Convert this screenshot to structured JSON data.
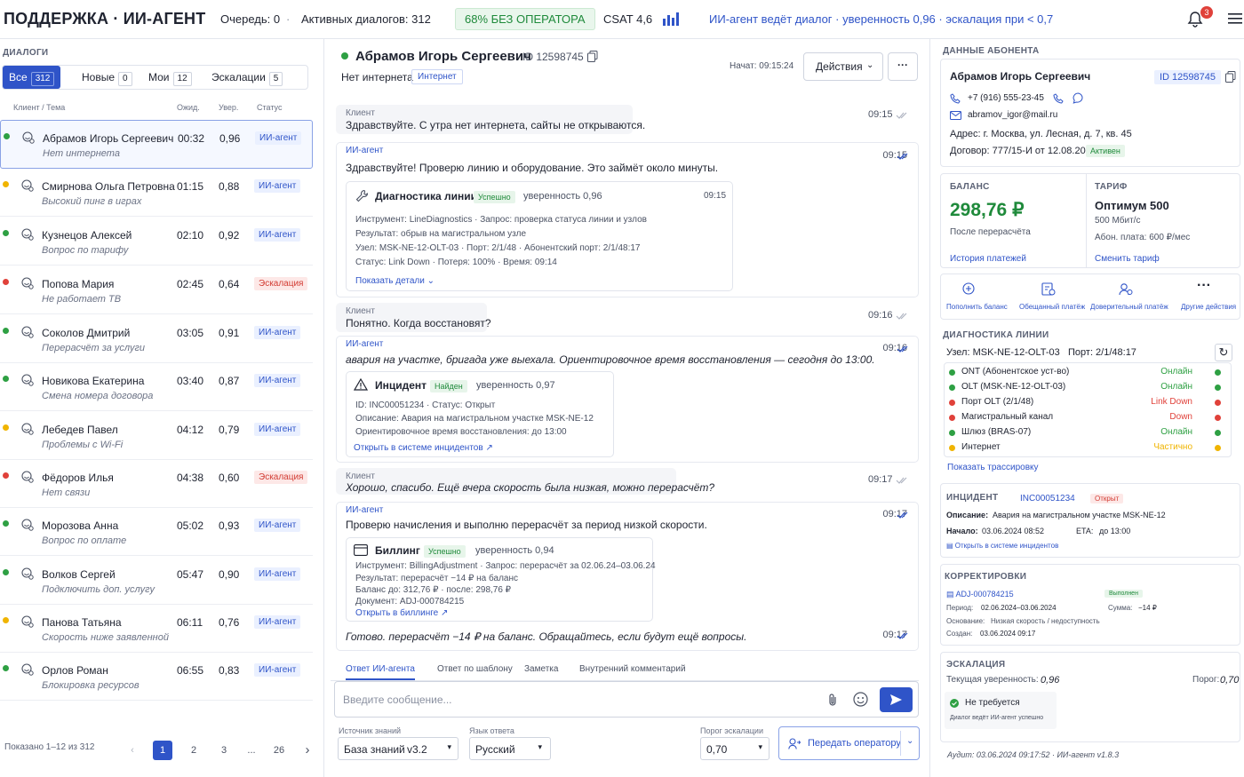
{
  "header": {
    "title": "ПОДДЕРЖКА · ИИ-АГЕНТ",
    "queue": "Очередь: 0",
    "sep": "·",
    "active": "Активных диалогов: 312",
    "no_operator": "68% БЕЗ ОПЕРАТОРА",
    "csat": "CSAT 4,6",
    "ai_status": "ИИ-агент ведёт диалог · уверенность 0,96 · эскалация при < 0,7",
    "notifications": "3"
  },
  "dialogs": {
    "section_title": "ДИАЛОГИ",
    "filters": [
      {
        "label": "Все",
        "count": "312"
      },
      {
        "label": "Новые",
        "count": "0"
      },
      {
        "label": "Мои",
        "count": "12"
      },
      {
        "label": "Эскалации",
        "count": "5"
      }
    ],
    "columns": [
      "Клиент / Тема",
      "Ожид.",
      "Увер.",
      "Статус"
    ],
    "rows": [
      {
        "name": "Абрамов Игорь Сергеевич",
        "topic": "Нет интернета",
        "wait": "00:32",
        "conf": "0,96",
        "status": "ИИ-агент",
        "dot": "#2ea043",
        "kind": "ai"
      },
      {
        "name": "Смирнова Ольга Петровна",
        "topic": "Высокий пинг в играх",
        "wait": "01:15",
        "conf": "0,88",
        "status": "ИИ-агент",
        "dot": "#f0b400",
        "kind": "ai"
      },
      {
        "name": "Кузнецов Алексей",
        "topic": "Вопрос по тарифу",
        "wait": "02:10",
        "conf": "0,92",
        "status": "ИИ-агент",
        "dot": "#2ea043",
        "kind": "ai"
      },
      {
        "name": "Попова Мария",
        "topic": "Не работает ТВ",
        "wait": "02:45",
        "conf": "0,64",
        "status": "Эскалация",
        "dot": "#e0413a",
        "kind": "esc"
      },
      {
        "name": "Соколов Дмитрий",
        "topic": "Перерасчёт за услуги",
        "wait": "03:05",
        "conf": "0,91",
        "status": "ИИ-агент",
        "dot": "#2ea043",
        "kind": "ai"
      },
      {
        "name": "Новикова Екатерина",
        "topic": "Смена номера договора",
        "wait": "03:40",
        "conf": "0,87",
        "status": "ИИ-агент",
        "dot": "#2ea043",
        "kind": "ai"
      },
      {
        "name": "Лебедев Павел",
        "topic": "Проблемы с Wi-Fi",
        "wait": "04:12",
        "conf": "0,79",
        "status": "ИИ-агент",
        "dot": "#f0b400",
        "kind": "ai"
      },
      {
        "name": "Фёдоров Илья",
        "topic": "Нет связи",
        "wait": "04:38",
        "conf": "0,60",
        "status": "Эскалация",
        "dot": "#e0413a",
        "kind": "esc"
      },
      {
        "name": "Морозова Анна",
        "topic": "Вопрос по оплате",
        "wait": "05:02",
        "conf": "0,93",
        "status": "ИИ-агент",
        "dot": "#2ea043",
        "kind": "ai"
      },
      {
        "name": "Волков Сергей",
        "topic": "Подключить доп. услугу",
        "wait": "05:47",
        "conf": "0,90",
        "status": "ИИ-агент",
        "dot": "#2ea043",
        "kind": "ai"
      },
      {
        "name": "Панова Татьяна",
        "topic": "Скорость ниже заявленной",
        "wait": "06:11",
        "conf": "0,76",
        "status": "ИИ-агент",
        "dot": "#f0b400",
        "kind": "ai"
      },
      {
        "name": "Орлов Роман",
        "topic": "Блокировка ресурсов",
        "wait": "06:55",
        "conf": "0,83",
        "status": "ИИ-агент",
        "dot": "#2ea043",
        "kind": "ai"
      }
    ],
    "pager_info": "Показано 1–12 из 312",
    "pages": [
      "1",
      "2",
      "3",
      "...",
      "26"
    ]
  },
  "chat": {
    "name": "Абрамов Игорь Сергеевич",
    "id": "ID 12598745",
    "subject": "Нет интернета",
    "tag": "Интернет",
    "started": "Начат: 09:15:24",
    "actions": "Действия",
    "messages": [
      {
        "role": "Клиент",
        "text": "Здравствуйте. С утра нет интернета, сайты не открываются.",
        "time": "09:15"
      },
      {
        "role": "ИИ-агент",
        "text": "Здравствуйте! Проверю линию и оборудование. Это займёт около минуты.",
        "time": "09:15"
      },
      {
        "role": "Клиент",
        "text": "Понятно. Когда восстановят?",
        "time": "09:16"
      },
      {
        "role": "ИИ-агент",
        "text": "авария на участке, бригада уже выехала. Ориентировочное время восстановления — сегодня до 13:00.",
        "time": "09:16"
      },
      {
        "role": "Клиент",
        "text": "Хорошо, спасибо. Ещё вчера скорость была низкая, можно перерасчёт?",
        "time": "09:17"
      },
      {
        "role": "ИИ-агент",
        "text": "Проверю начисления и выполню перерасчёт за период низкой скорости.",
        "time": "09:17"
      },
      {
        "text": "Готово. перерасчёт −14 ₽ на баланс. Обращайтесь, если будут ещё вопросы.",
        "time": "09:17"
      }
    ],
    "diag_card": {
      "title": "Диагностика линии",
      "badge": "Успешно",
      "conf": "уверенность 0,96",
      "time": "09:15",
      "lines": [
        "Инструмент: LineDiagnostics · Запрос: проверка статуса линии и узлов",
        "Результат: обрыв на магистральном узле",
        "Узел: MSK-NE-12-OLT-03 · Порт: 2/1/48 · Абонентский порт: 2/1/48:17",
        "Статус: Link Down · Потеря: 100% · Время: 09:14"
      ],
      "link": "Показать детали"
    },
    "incident_card": {
      "title": "Инцидент",
      "badge": "Найден",
      "conf": "уверенность 0,97",
      "lines": [
        "ID: INC00051234 · Статус: Открыт",
        "Описание: Авария на магистральном участке MSK-NE-12",
        "Ориентировочное время восстановления: до 13:00"
      ],
      "link": "Открыть в системе инцидентов"
    },
    "billing_card": {
      "title": "Биллинг",
      "badge": "Успешно",
      "conf": "уверенность 0,94",
      "lines": [
        "Инструмент: BillingAdjustment · Запрос: перерасчёт за 02.06.24–03.06.24",
        "Результат: перерасчёт −14 ₽ на баланс",
        "Баланс до: 312,76 ₽ · после: 298,76 ₽",
        "Документ: ADJ-000784215"
      ],
      "link": "Открыть в биллинге"
    },
    "tabs": [
      "Ответ ИИ-агента",
      "Ответ по шаблону",
      "Заметка",
      "Внутренний комментарий"
    ],
    "input_placeholder": "Введите сообщение...",
    "kb_label": "Источник знаний",
    "kb_value": "База знаний",
    "kb_version": "v3.2",
    "lang_label": "Язык ответа",
    "lang_value": "Русский",
    "thr_label": "Порог эскалации",
    "thr_value": "0,70",
    "handover": "Передать оператору"
  },
  "subscriber": {
    "section_title": "ДАННЫЕ АБОНЕНТА",
    "name": "Абрамов Игорь Сергеевич",
    "id": "ID 12598745",
    "phone": "+7 (916) 555-23-45",
    "email": "abramov_igor@mail.ru",
    "address": "Адрес: г. Москва, ул. Лесная, д. 7, кв. 45",
    "contract": "Договор: 777/15-И от 12.08.2021",
    "contract_status": "Активен",
    "balance_label": "БАЛАНС",
    "balance": "298,76 ₽",
    "balance_note": "После перерасчёта",
    "balance_link": "История платежей",
    "tariff_label": "ТАРИФ",
    "tariff": "Оптимум 500",
    "tariff_speed": "500 Мбит/с",
    "tariff_fee": "Абон. плата: 600 ₽/мес",
    "tariff_link": "Сменить тариф",
    "actions": [
      "Пополнить баланс",
      "Обещанный платёж",
      "Доверительный платёж",
      "Другие действия"
    ]
  },
  "line_diag": {
    "title": "ДИАГНОСТИКА ЛИНИИ",
    "node": "Узел: MSK-NE-12-OLT-03",
    "port": "Порт: 2/1/48:17",
    "rows": [
      {
        "label": "ONT (Абонентское уст-во)",
        "value": "Онлайн",
        "color": "#2ea043"
      },
      {
        "label": "OLT (MSK-NE-12-OLT-03)",
        "value": "Онлайн",
        "color": "#2ea043"
      },
      {
        "label": "Порт OLT (2/1/48)",
        "value": "Link Down",
        "color": "#e0413a"
      },
      {
        "label": "Магистральный канал",
        "value": "Down",
        "color": "#e0413a"
      },
      {
        "label": "Шлюз (BRAS-07)",
        "value": "Онлайн",
        "color": "#2ea043"
      },
      {
        "label": "Интернет",
        "value": "Частично",
        "color": "#f0b400"
      }
    ],
    "link": "Показать трассировку"
  },
  "incident": {
    "title": "ИНЦИДЕНТ",
    "id": "INC00051234",
    "status": "Открыт",
    "desc_label": "Описание:",
    "desc": "Авария на магистральном участке MSK-NE-12",
    "start_label": "Начало:",
    "start": "03.06.2024 08:52",
    "eta_label": "ETA:",
    "eta": "до 13:00",
    "link": "Открыть в системе инцидентов"
  },
  "corrections": {
    "title": "КОРРЕКТИРОВКИ",
    "id": "ADJ-000784215",
    "status": "Выполнен",
    "period_label": "Период:",
    "period": "02.06.2024–03.06.2024",
    "sum_label": "Сумма:",
    "sum": "−14 ₽",
    "reason_label": "Основание:",
    "reason": "Низкая скорость / недоступность",
    "created_label": "Создан:",
    "created": "03.06.2024 09:17"
  },
  "escalation": {
    "title": "ЭСКАЛАЦИЯ",
    "conf_label": "Текущая уверенность:",
    "conf": "0,96",
    "thr_label": "Порог:",
    "thr": "0,70",
    "status": "Не требуется",
    "note": "Диалог ведёт ИИ-агент успешно",
    "audit": "Аудит: 03.06.2024 09:17:52 · ИИ-агент v1.8.3"
  },
  "colors": {
    "accent": "#2f54c8",
    "ok": "#2ea043",
    "warn": "#f0b400",
    "error": "#e0413a"
  }
}
